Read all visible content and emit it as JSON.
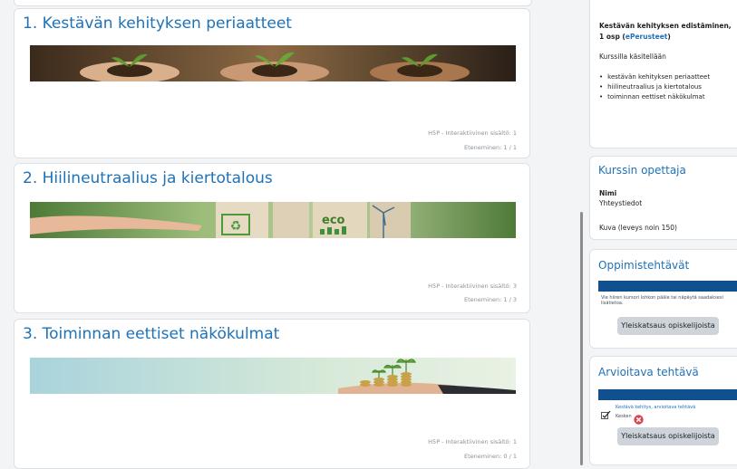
{
  "courses": [
    {
      "title": "1. Kestävän kehityksen periaatteet",
      "meta": "H5P - Interaktiivinen sisältö: 1",
      "progress": "Eteneminen: 1 / 1"
    },
    {
      "title": "2. Hiilineutraalius ja kiertotalous",
      "meta": "H5P - Interaktiivinen sisältö: 3",
      "progress": "Eteneminen: 1 / 3"
    },
    {
      "title": "3. Toiminnan eettiset näkökulmat",
      "meta": "H5P - Interaktiivinen sisältö: 1",
      "progress": "Eteneminen: 0 / 1"
    }
  ],
  "banner_eco": "eco",
  "sidebar": {
    "about": {
      "title_line1": "Kestävän kehityksen edistäminen,",
      "title_line2a": "1 osp (",
      "title_link": "ePerusteet",
      "title_line2b": ")",
      "intro": "Kurssilla käsitellään",
      "items": [
        "kestävän kehityksen periaatteet",
        "hiilineutraalius ja kiertotalous",
        "toiminnan eettiset näkökulmat"
      ]
    },
    "teacher": {
      "heading": "Kurssin opettaja",
      "name": "Nimi",
      "contact": "Yhteystiedot",
      "photo": "Kuva (leveys noin 150)"
    },
    "tasks": {
      "heading": "Oppimistehtävät",
      "hint": "Vie hiiren kursori lohkon pääle tai näpäytä saadaksesi lisätietoa.",
      "button": "Yleiskatsaus opiskelijoista"
    },
    "graded": {
      "heading": "Arvioitava tehtävä",
      "item_line1": "Kestävä kehitys, arvioitava tehtävä",
      "item_line2": "Kesken",
      "button": "Yleiskatsaus opiskelijoista"
    }
  },
  "colors": {
    "accent": "#1e72b8",
    "bar": "#11508e",
    "button": "#ced4da"
  }
}
